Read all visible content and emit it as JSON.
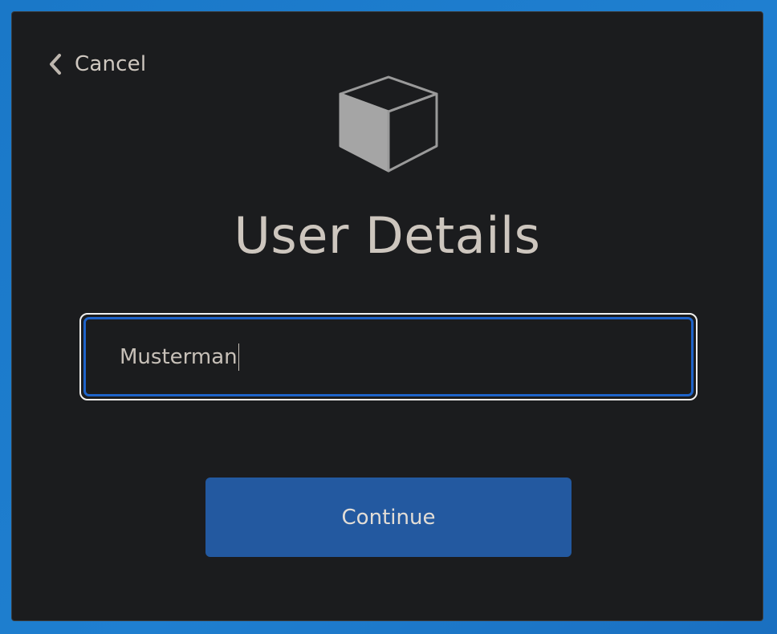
{
  "dialog": {
    "cancel_label": "Cancel",
    "title": "User Details",
    "name_field": {
      "value": "Musterman"
    },
    "continue_label": "Continue"
  },
  "icons": {
    "back": "chevron-left-icon",
    "logo": "cube-icon"
  },
  "colors": {
    "dialog_background": "#1b1c1e",
    "accent_button": "#2359a0",
    "focus_ring": "#1e63c9",
    "text": "#cdc6be"
  }
}
